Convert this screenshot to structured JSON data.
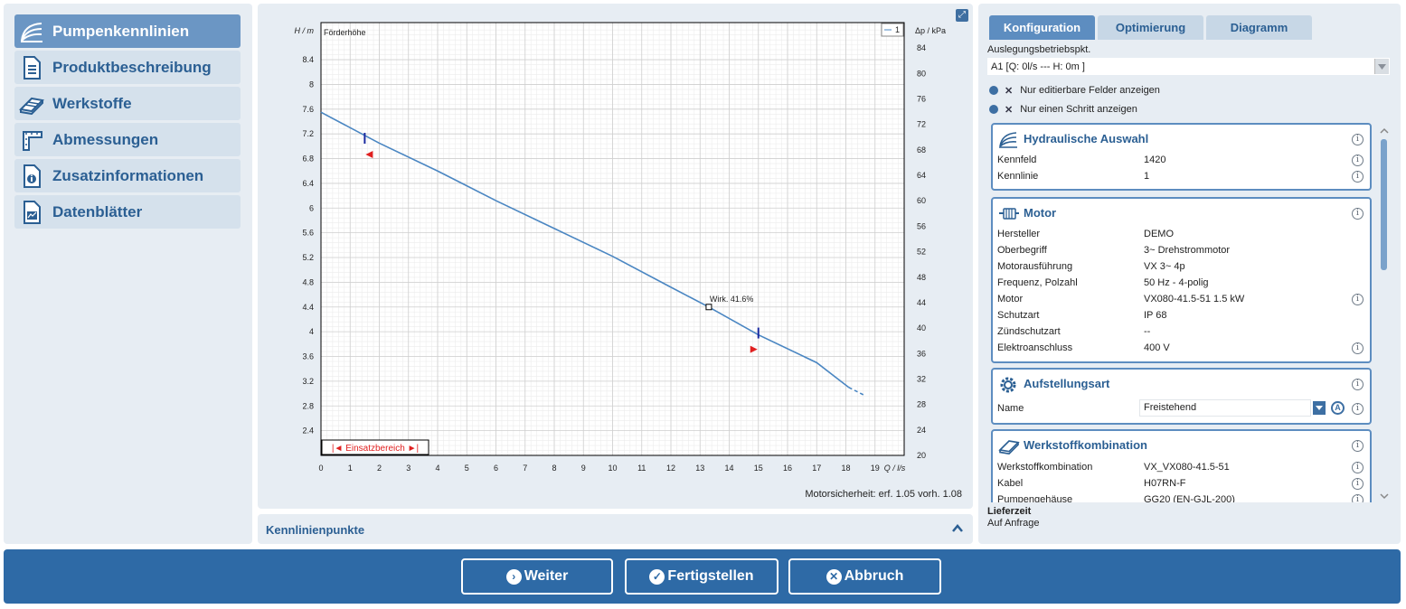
{
  "nav": {
    "items": [
      {
        "label": "Pumpenkennlinien",
        "icon": "curve-icon",
        "active": true
      },
      {
        "label": "Produktbeschreibung",
        "icon": "document-icon",
        "active": false
      },
      {
        "label": "Werkstoffe",
        "icon": "materials-icon",
        "active": false
      },
      {
        "label": "Abmessungen",
        "icon": "dimensions-icon",
        "active": false
      },
      {
        "label": "Zusatzinformationen",
        "icon": "info-document-icon",
        "active": false
      },
      {
        "label": "Datenblätter",
        "icon": "datasheet-icon",
        "active": false
      }
    ]
  },
  "chart_data": {
    "type": "line",
    "y_title": "H / m",
    "y_series_label": "Förderhöhe",
    "y2_title": "Δp / kPa",
    "x_title": "Q / l/s",
    "xlim": [
      0,
      20
    ],
    "ylim": [
      2.0,
      9.0
    ],
    "y2lim": [
      20,
      88
    ],
    "x_ticks": [
      0,
      1,
      2,
      3,
      4,
      5,
      6,
      7,
      8,
      9,
      10,
      11,
      12,
      13,
      14,
      15,
      16,
      17,
      18,
      19
    ],
    "y_ticks": [
      2.4,
      2.8,
      3.2,
      3.6,
      4,
      4.4,
      4.8,
      5.2,
      5.6,
      6,
      6.4,
      6.8,
      7.2,
      7.6,
      8,
      8.4
    ],
    "y2_ticks": [
      20,
      24,
      28,
      32,
      36,
      40,
      44,
      48,
      52,
      56,
      60,
      64,
      68,
      72,
      76,
      80,
      84
    ],
    "legend": "1",
    "series": [
      {
        "name": "1",
        "color": "#4a86c2",
        "x": [
          0,
          2,
          4,
          6,
          8,
          10,
          12,
          13.3,
          15,
          17,
          18.1
        ],
        "y": [
          7.55,
          7.05,
          6.6,
          6.12,
          5.67,
          5.22,
          4.72,
          4.4,
          3.95,
          3.5,
          3.1
        ]
      },
      {
        "name": "",
        "dashed": true,
        "color": "#4a86c2",
        "x": [
          18.1,
          18.6
        ],
        "y": [
          3.1,
          2.98
        ]
      }
    ],
    "annotation": {
      "text": "Wirk.  41.6%",
      "x": 13.3,
      "y": 4.4
    },
    "range_markers": [
      {
        "x": 1.5,
        "y": 7.1
      },
      {
        "x": 15.0,
        "y": 3.95
      }
    ],
    "range_label": "Einsatzbereich",
    "grid": true
  },
  "motor_safety": "Motorsicherheit: erf. 1.05  vorh. 1.08",
  "curve_panel": {
    "title": "Kennlinienpunkte"
  },
  "tabs": [
    {
      "label": "Konfiguration",
      "active": true
    },
    {
      "label": "Optimierung",
      "active": false
    },
    {
      "label": "Diagramm",
      "active": false
    }
  ],
  "design_point": {
    "label": "Auslegungsbetriebspkt.",
    "value": "A1 [Q: 0l/s --- H: 0m ]"
  },
  "options": [
    {
      "label": "Nur editierbare Felder anzeigen"
    },
    {
      "label": "Nur einen Schritt anzeigen"
    }
  ],
  "sections": [
    {
      "title": "Hydraulische Auswahl",
      "icon": "curve-icon",
      "rows": [
        {
          "label": "Kennfeld",
          "value": "1420",
          "info": true
        },
        {
          "label": "Kennlinie",
          "value": "1",
          "info": true
        }
      ]
    },
    {
      "title": "Motor",
      "icon": "motor-icon",
      "rows": [
        {
          "label": "Hersteller",
          "value": "DEMO",
          "info": false
        },
        {
          "label": "Oberbegriff",
          "value": "3~ Drehstrommotor",
          "info": false
        },
        {
          "label": "Motorausführung",
          "value": "VX 3~ 4p",
          "info": false
        },
        {
          "label": "Frequenz, Polzahl",
          "value": "50 Hz - 4-polig",
          "info": false
        },
        {
          "label": "Motor",
          "value": "VX080-41.5-51   1.5 kW",
          "info": true
        },
        {
          "label": "Schutzart",
          "value": "IP 68",
          "info": false
        },
        {
          "label": "Zündschutzart",
          "value": "--",
          "info": false
        },
        {
          "label": "Elektroanschluss",
          "value": "400 V",
          "info": true
        }
      ]
    },
    {
      "title": "Aufstellungsart",
      "icon": "gear-icon",
      "rows": [
        {
          "label": "Name",
          "value": "Freistehend",
          "info": true
        }
      ]
    },
    {
      "title": "Werkstoffkombination",
      "icon": "materials-icon",
      "rows": [
        {
          "label": "Werkstoffkombination",
          "value": "VX_VX080-41.5-51",
          "info": true
        },
        {
          "label": "Kabel",
          "value": "H07RN-F",
          "info": true
        },
        {
          "label": "Pumpengehäuse",
          "value": "GG20 (EN-GJL-200)",
          "info": true
        }
      ]
    }
  ],
  "delivery": {
    "label": "Lieferzeit",
    "value": "Auf Anfrage"
  },
  "footer": {
    "buttons": [
      {
        "label": "Weiter",
        "icon": "arrow-right-icon"
      },
      {
        "label": "Fertigstellen",
        "icon": "check-icon"
      },
      {
        "label": "Abbruch",
        "icon": "close-icon"
      }
    ]
  }
}
